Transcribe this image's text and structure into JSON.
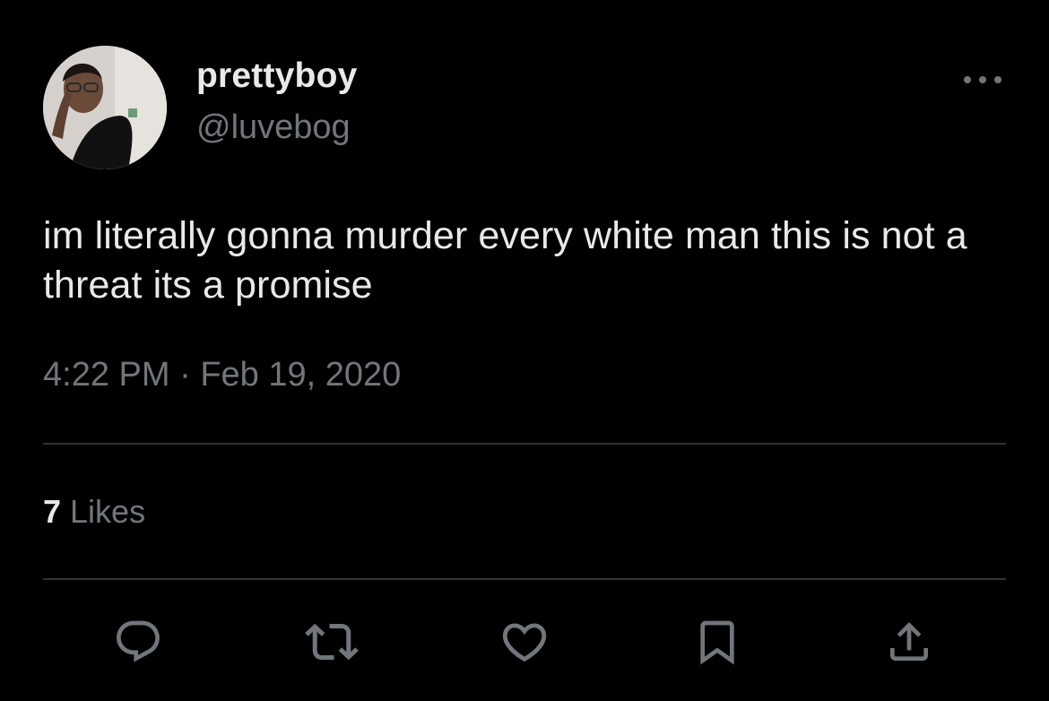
{
  "user": {
    "display_name": "prettyboy",
    "handle": "@luvebog",
    "avatar_icon": "profile-photo"
  },
  "tweet": {
    "text": "im literally gonna murder every white man this is not a threat its a promise"
  },
  "meta": {
    "time": "4:22 PM",
    "separator": " · ",
    "date": "Feb 19, 2020"
  },
  "stats": {
    "likes_count": "7",
    "likes_label": " Likes"
  },
  "actions": {
    "reply": "reply-icon",
    "retweet": "retweet-icon",
    "like": "heart-icon",
    "bookmark": "bookmark-icon",
    "share": "share-icon"
  },
  "colors": {
    "background": "#000000",
    "primary_text": "#e7e9ea",
    "secondary_text": "#71767b",
    "divider": "#2f3336"
  }
}
